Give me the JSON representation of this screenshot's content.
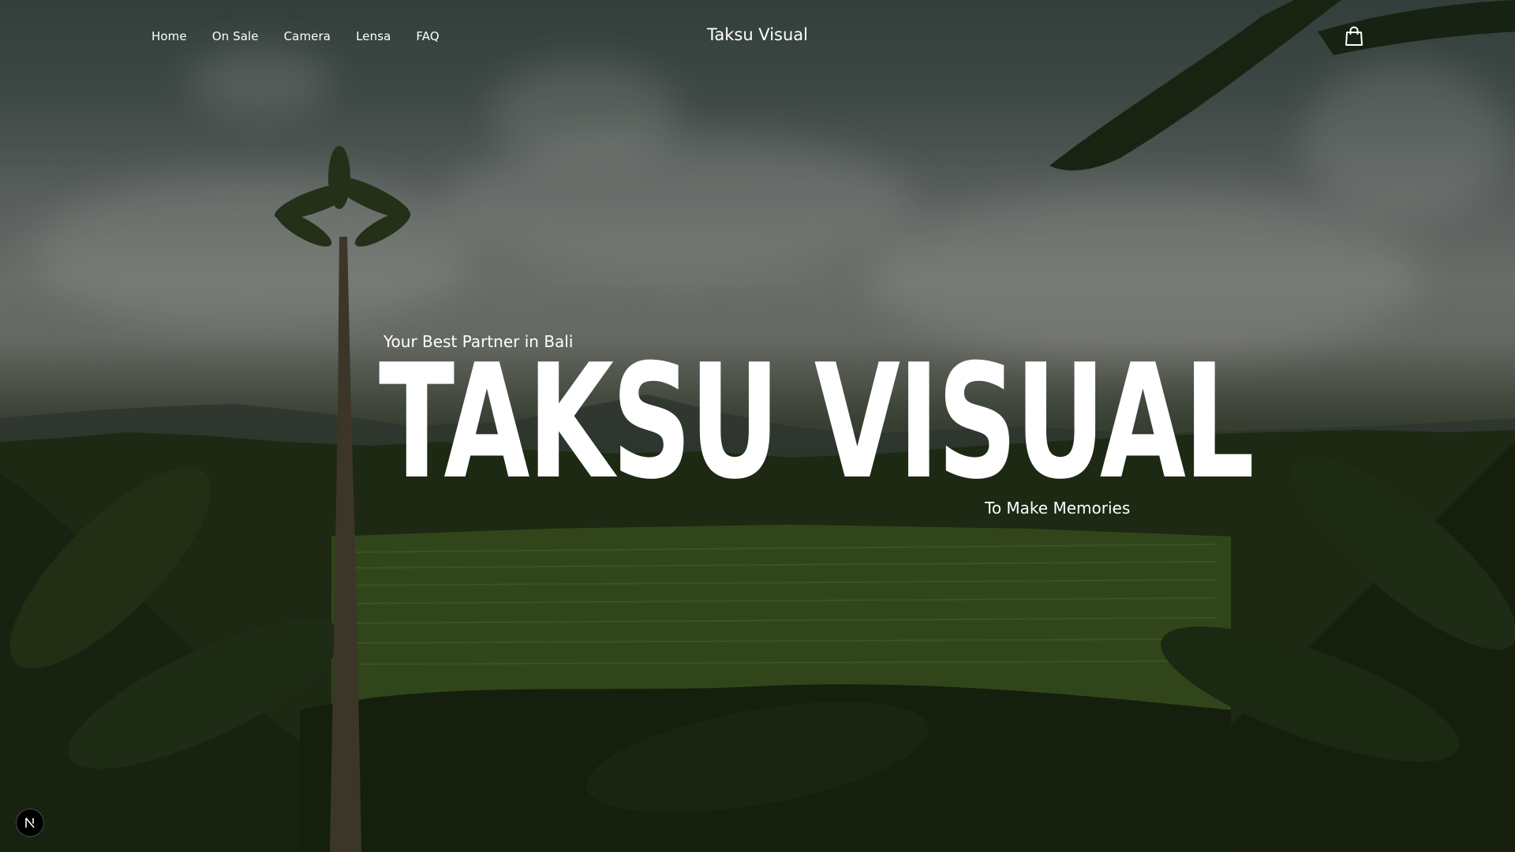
{
  "nav": {
    "items": [
      {
        "label": "Home"
      },
      {
        "label": "On Sale"
      },
      {
        "label": "Camera"
      },
      {
        "label": "Lensa"
      },
      {
        "label": "FAQ"
      }
    ],
    "brand": "Taksu Visual",
    "cart_icon": "shopping-bag-icon"
  },
  "hero": {
    "tagline": "Your Best Partner in Bali",
    "title": "TAKSU VISUAL",
    "subline": "To Make Memories",
    "background": "rice-terrace-landscape-photo"
  },
  "badge": {
    "icon": "nextjs-n-icon"
  },
  "colors": {
    "text": "#ffffff",
    "badge_bg": "#000000"
  }
}
